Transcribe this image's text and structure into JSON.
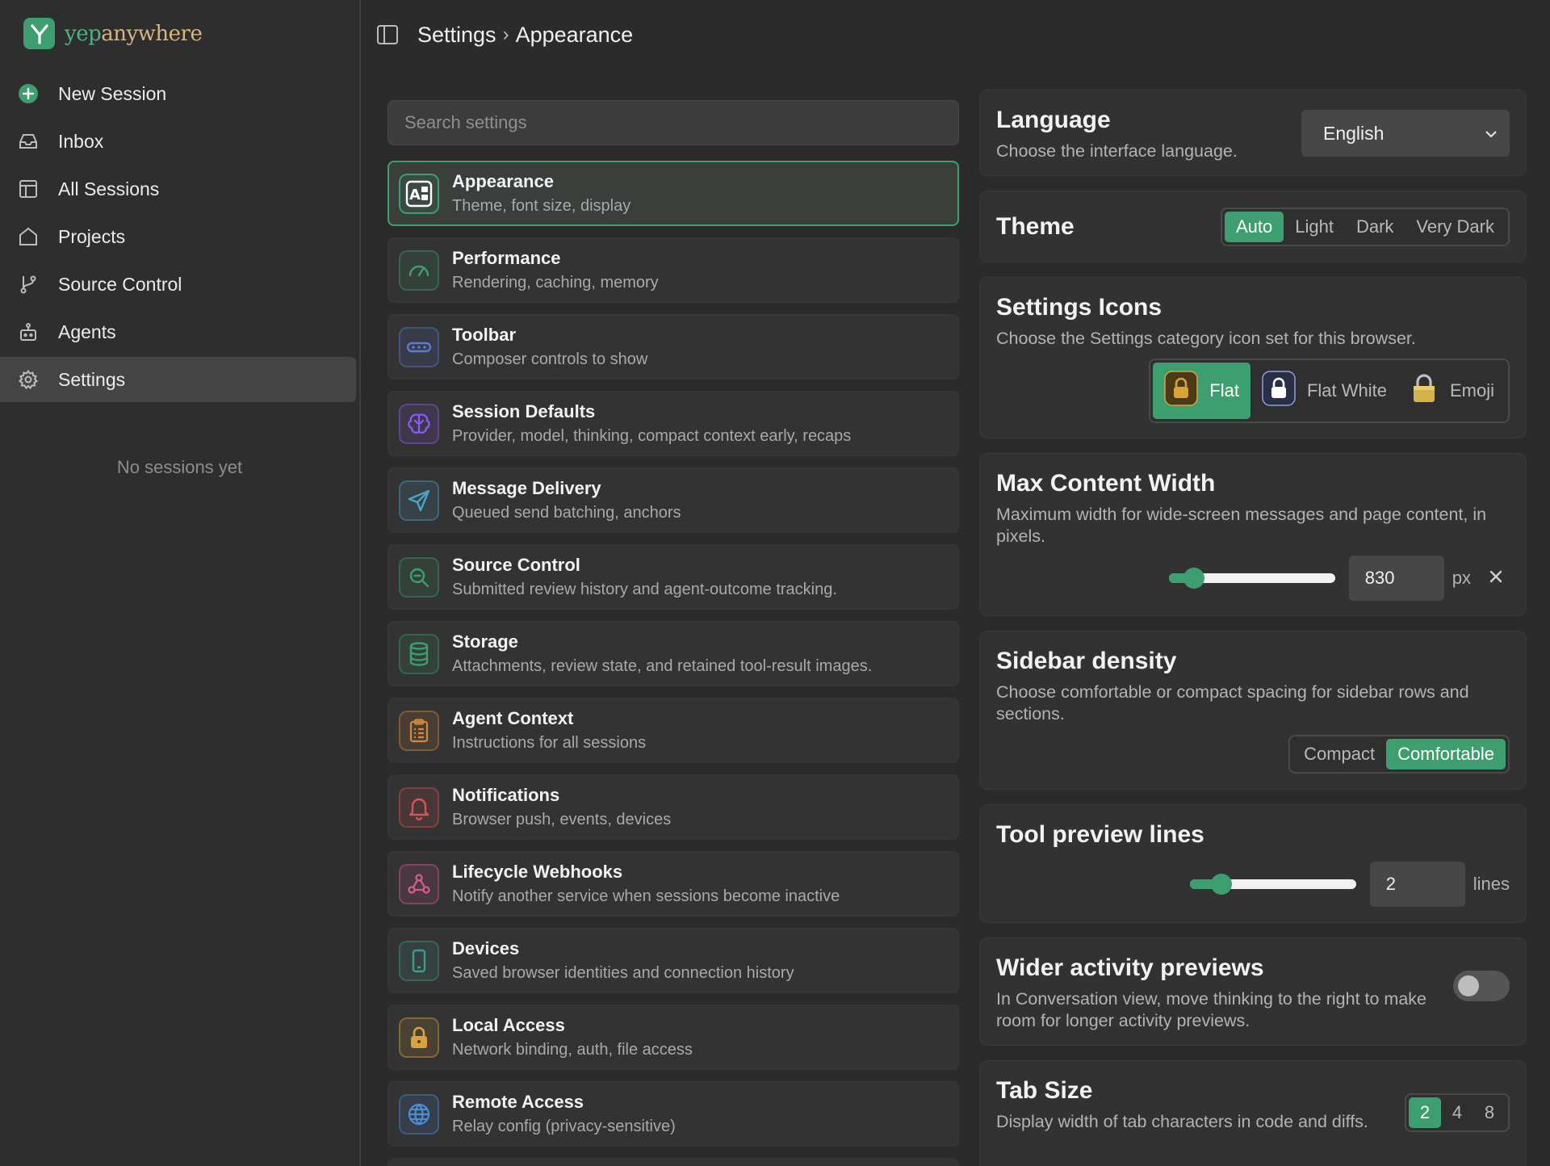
{
  "brand": {
    "yep": "yep",
    "anywhere": "anywhere"
  },
  "nav": {
    "items": [
      {
        "label": "New Session",
        "icon": "plus-circle-icon"
      },
      {
        "label": "Inbox",
        "icon": "inbox-icon"
      },
      {
        "label": "All Sessions",
        "icon": "layout-icon"
      },
      {
        "label": "Projects",
        "icon": "home-icon"
      },
      {
        "label": "Source Control",
        "icon": "git-branch-icon"
      },
      {
        "label": "Agents",
        "icon": "robot-icon"
      },
      {
        "label": "Settings",
        "icon": "gear-icon",
        "active": true
      }
    ],
    "empty_text": "No sessions yet"
  },
  "header": {
    "crumb_root": "Settings",
    "separator": "›",
    "crumb_current": "Appearance"
  },
  "search": {
    "placeholder": "Search settings",
    "value": ""
  },
  "categories": [
    {
      "title": "Appearance",
      "desc": "Theme, font size, display",
      "icon": "appearance-icon",
      "color": "#3d9e6f",
      "active": true
    },
    {
      "title": "Performance",
      "desc": "Rendering, caching, memory",
      "icon": "gauge-icon",
      "color": "#3d9e6f"
    },
    {
      "title": "Toolbar",
      "desc": "Composer controls to show",
      "icon": "toolbar-icon",
      "color": "#5b7bd5"
    },
    {
      "title": "Session Defaults",
      "desc": "Provider, model, thinking, compact context early, recaps",
      "icon": "brain-icon",
      "color": "#8b5cf6"
    },
    {
      "title": "Message Delivery",
      "desc": "Queued send batching, anchors",
      "icon": "send-icon",
      "color": "#4aa3c7"
    },
    {
      "title": "Source Control",
      "desc": "Submitted review history and agent-outcome tracking.",
      "icon": "search-zoom-icon",
      "color": "#3d9e6f"
    },
    {
      "title": "Storage",
      "desc": "Attachments, review state, and retained tool-result images.",
      "icon": "database-icon",
      "color": "#3d9e6f"
    },
    {
      "title": "Agent Context",
      "desc": "Instructions for all sessions",
      "icon": "clipboard-icon",
      "color": "#d28a3a"
    },
    {
      "title": "Notifications",
      "desc": "Browser push, events, devices",
      "icon": "bell-icon",
      "color": "#d65454"
    },
    {
      "title": "Lifecycle Webhooks",
      "desc": "Notify another service when sessions become inactive",
      "icon": "webhook-icon",
      "color": "#d65a8f"
    },
    {
      "title": "Devices",
      "desc": "Saved browser identities and connection history",
      "icon": "phone-icon",
      "color": "#3d9e8f"
    },
    {
      "title": "Local Access",
      "desc": "Network binding, auth, file access",
      "icon": "lock-icon",
      "color": "#d9a23a"
    },
    {
      "title": "Remote Access",
      "desc": "Relay config (privacy-sensitive)",
      "icon": "globe-icon",
      "color": "#4a8fd6"
    }
  ],
  "settings": {
    "language": {
      "title": "Language",
      "desc": "Choose the interface language.",
      "value": "English"
    },
    "theme": {
      "title": "Theme",
      "options": [
        "Auto",
        "Light",
        "Dark",
        "Very Dark"
      ],
      "selected": "Auto"
    },
    "settings_icons": {
      "title": "Settings Icons",
      "desc": "Choose the Settings category icon set for this browser.",
      "options": [
        "Flat",
        "Flat White",
        "Emoji"
      ],
      "selected": "Flat"
    },
    "max_width": {
      "title": "Max Content Width",
      "desc": "Maximum width for wide-screen messages and page content, in pixels.",
      "value": "830",
      "unit": "px",
      "slider_fraction": 0.15
    },
    "sidebar_density": {
      "title": "Sidebar density",
      "desc": "Choose comfortable or compact spacing for sidebar rows and sections.",
      "options": [
        "Compact",
        "Comfortable"
      ],
      "selected": "Comfortable"
    },
    "tool_preview": {
      "title": "Tool preview lines",
      "value": "2",
      "unit": "lines",
      "slider_fraction": 0.19
    },
    "wider_previews": {
      "title": "Wider activity previews",
      "desc": "In Conversation view, move thinking to the right to make room for longer activity previews.",
      "enabled": false
    },
    "tab_size": {
      "title": "Tab Size",
      "desc": "Display width of tab characters in code and diffs.",
      "options": [
        "2",
        "4",
        "8"
      ],
      "selected": "2"
    }
  },
  "colors": {
    "accent": "#3d9e6f",
    "background": "#2b2b2b",
    "card": "#323232"
  }
}
